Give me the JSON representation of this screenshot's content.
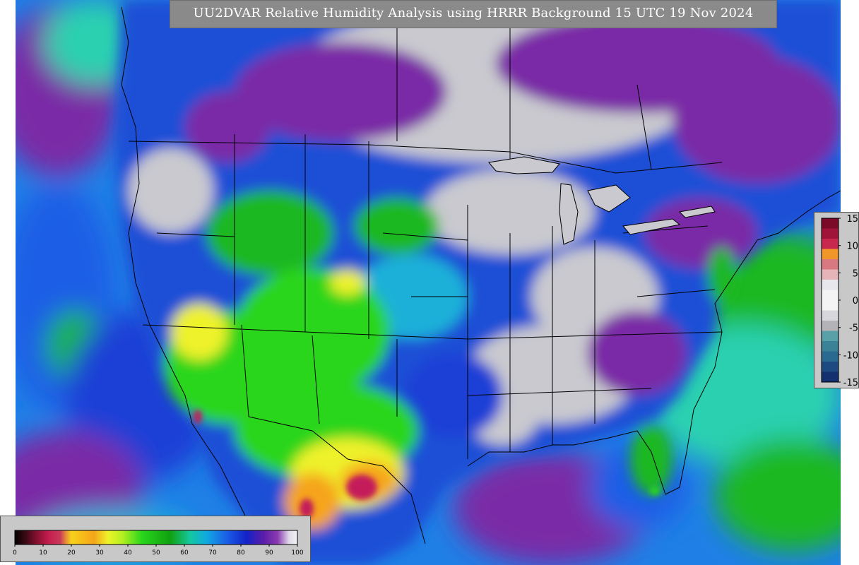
{
  "title": "UU2DVAR Relative Humidity Analysis using HRRR Background 15 UTC 19 Nov 2024",
  "colors": {
    "ocean_base": "#1f7fe6",
    "humid_purple": "#7a2aa6",
    "near_saturation_gray": "#c9c9cf",
    "moderate_green": "#1fb820",
    "dry_yellow": "#f2e41a",
    "very_dry_red": "#c41e5a",
    "boundary_lines": "#000000",
    "legend_background": "#c8c8c8",
    "title_background": "#8a8a8a"
  },
  "rh_scale": {
    "tick_labels": [
      "0",
      "10",
      "20",
      "30",
      "40",
      "50",
      "60",
      "70",
      "80",
      "90",
      "100"
    ],
    "range": [
      0,
      100
    ],
    "stops": [
      {
        "value": 0,
        "color": "#000000"
      },
      {
        "value": 4,
        "color": "#3d0a14"
      },
      {
        "value": 8,
        "color": "#8a1030"
      },
      {
        "value": 12,
        "color": "#c41e4e"
      },
      {
        "value": 16,
        "color": "#c8385a"
      },
      {
        "value": 18,
        "color": "#e88a3a"
      },
      {
        "value": 20,
        "color": "#f7d21a"
      },
      {
        "value": 28,
        "color": "#f5a41a"
      },
      {
        "value": 33,
        "color": "#eef22a"
      },
      {
        "value": 38,
        "color": "#b4f020"
      },
      {
        "value": 45,
        "color": "#29d61c"
      },
      {
        "value": 55,
        "color": "#10a010"
      },
      {
        "value": 62,
        "color": "#14c8a0"
      },
      {
        "value": 68,
        "color": "#10a8e0"
      },
      {
        "value": 75,
        "color": "#1a5ee6"
      },
      {
        "value": 82,
        "color": "#1222c8"
      },
      {
        "value": 88,
        "color": "#5a1ea8"
      },
      {
        "value": 93,
        "color": "#8a3ab0"
      },
      {
        "value": 97,
        "color": "#e0d8e8"
      },
      {
        "value": 100,
        "color": "#f4f4f4"
      }
    ]
  },
  "increment_scale": {
    "tick_labels": [
      "15",
      "10",
      "5",
      "0",
      "-5",
      "-10",
      "-15"
    ],
    "range": [
      -15,
      15
    ],
    "segments": [
      "#7a0a28",
      "#a0143a",
      "#c8284e",
      "#f0962a",
      "#d87880",
      "#e4b4b8",
      "#e8e8ec",
      "#f4f4f4",
      "#f4f4f4",
      "#d8d8dc",
      "#b4b4b8",
      "#5aa0a8",
      "#3c8296",
      "#2a6a90",
      "#1e4a82",
      "#15306e"
    ]
  }
}
